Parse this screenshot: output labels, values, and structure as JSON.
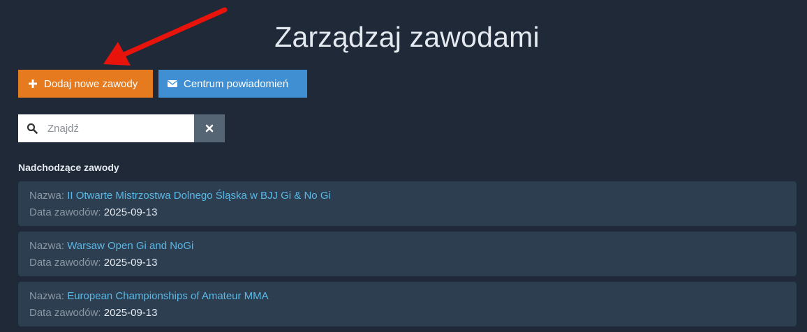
{
  "header": {
    "title": "Zarządzaj zawodami"
  },
  "actions": {
    "add_label": "Dodaj nowe zawody",
    "notify_label": "Centrum powiadomień"
  },
  "search": {
    "placeholder": "Znajdź",
    "value": ""
  },
  "section": {
    "title": "Nadchodzące zawody"
  },
  "labels": {
    "name": "Nazwa:",
    "date": "Data zawodów:"
  },
  "competitions": [
    {
      "name": "II Otwarte Mistrzostwa Dolnego Śląska w BJJ Gi & No Gi",
      "date": "2025-09-13"
    },
    {
      "name": "Warsaw Open Gi and NoGi",
      "date": "2025-09-13"
    },
    {
      "name": "European Championships of Amateur MMA",
      "date": "2025-09-13"
    }
  ],
  "icons": {
    "add": "plus-icon",
    "notify": "envelope-icon",
    "search": "search-icon",
    "clear": "close-icon",
    "annotation": "red-arrow"
  },
  "colors": {
    "background": "#1f2937",
    "card": "#2c3e50",
    "add_button": "#e67a1f",
    "notify_button": "#3f8fd2",
    "clear_button": "#566573",
    "link": "#5bb8e6",
    "annotation_arrow": "#e8140c"
  }
}
